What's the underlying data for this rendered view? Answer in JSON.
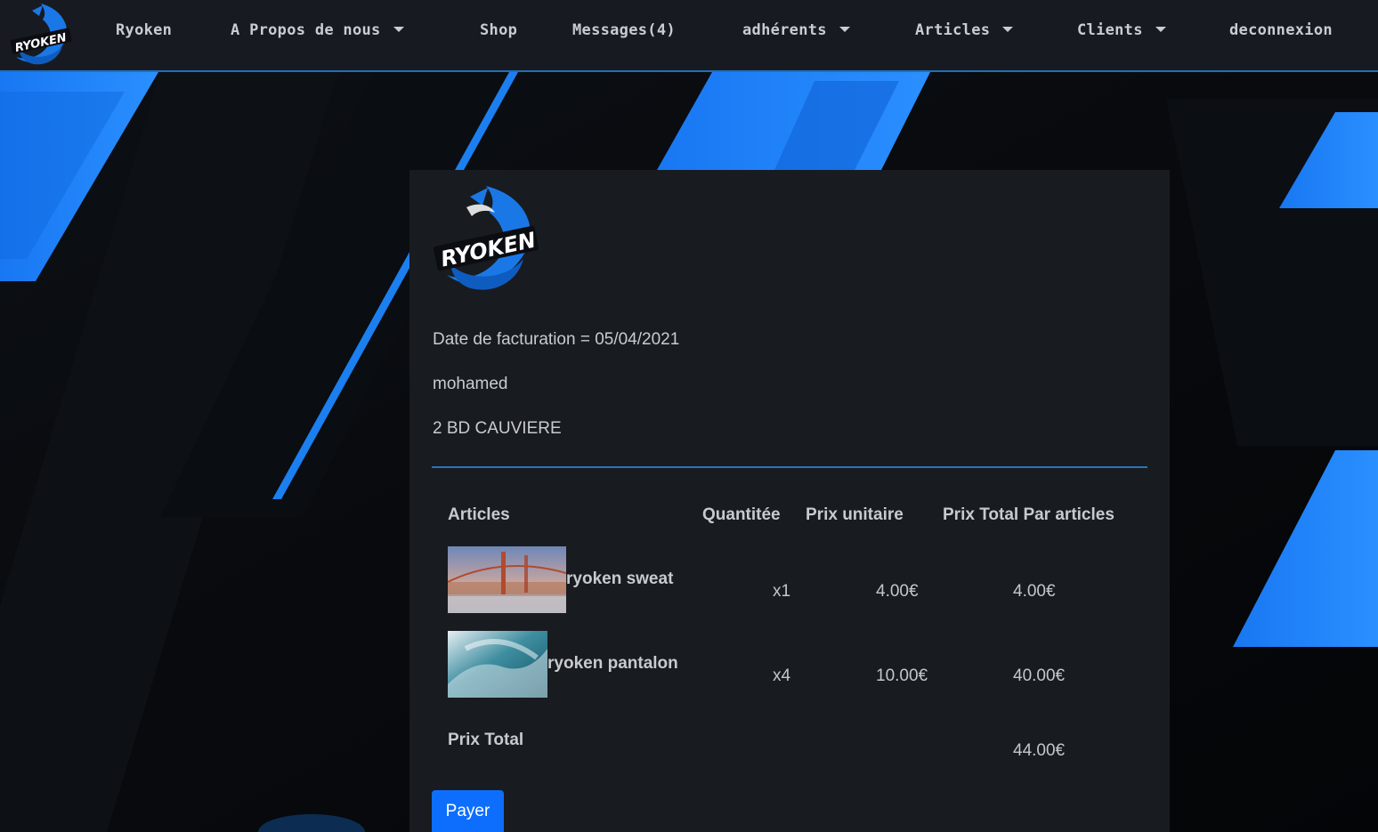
{
  "navbar": {
    "logo_text": "RYOKEN",
    "items": [
      {
        "label": "Ryoken",
        "dropdown": false
      },
      {
        "label": "A Propos de nous",
        "dropdown": true
      },
      {
        "label": "Shop",
        "dropdown": false
      },
      {
        "label": "Messages(4)",
        "dropdown": false
      },
      {
        "label": "adhérents",
        "dropdown": true
      },
      {
        "label": "Articles",
        "dropdown": true
      },
      {
        "label": "Clients",
        "dropdown": true
      },
      {
        "label": "deconnexion",
        "dropdown": false
      }
    ]
  },
  "invoice": {
    "logo_text": "RYOKEN",
    "date_line": "Date de facturation = 05/04/2021",
    "customer_name": "mohamed",
    "address": "2 BD CAUVIERE",
    "columns": {
      "article": "Articles",
      "quantity": "Quantitée",
      "unit_price": "Prix unitaire",
      "line_total": "Prix Total Par articles"
    },
    "rows": [
      {
        "name": "ryoken sweat",
        "quantity": "x1",
        "unit_price": "4.00€",
        "line_total": "4.00€",
        "thumb": "bridge-photo"
      },
      {
        "name": "ryoken pantalon",
        "quantity": "x4",
        "unit_price": "10.00€",
        "line_total": "40.00€",
        "thumb": "wave-photo"
      }
    ],
    "total_label": "Prix Total",
    "total_value": "44.00€",
    "pay_label": "Payer"
  },
  "colors": {
    "navbar_bg": "#171b21",
    "card_bg": "#181b20",
    "accent_blue": "#1a82ff",
    "button_blue": "#0d6efd"
  }
}
